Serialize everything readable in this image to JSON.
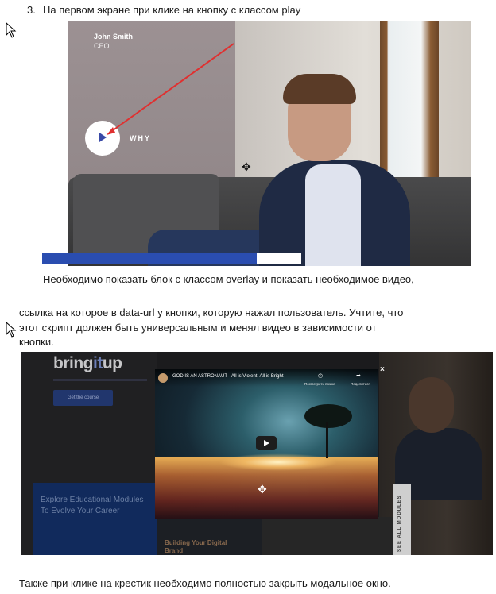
{
  "doc": {
    "item_number": "3.",
    "item_text": "На первом экране при клике на кнопку с классом play",
    "paragraph1": "Необходимо показать блок с классом overlay и показать необходимое видео,",
    "paragraph2_line1": "ссылка на которое в data-url у кнопки, которую нажал пользователь. Учтите, что",
    "paragraph2_line2": "этот скрипт должен быть универсальным и менял видео в зависимости от",
    "paragraph2_line3": "кнопки.",
    "paragraph3": "Также при клике на крестик необходимо полностью закрыть модальное окно."
  },
  "screenshot1": {
    "hero_name": "John Smith",
    "hero_role": "CEO",
    "why_label": "WHY",
    "play_icon": "play-icon",
    "move_icon": "move-cursor-icon",
    "annotation_color": "#e03030",
    "progress_color": "#2a4db0"
  },
  "screenshot2": {
    "brand_prefix": "bring",
    "brand_accent": "it",
    "brand_suffix": "up",
    "brand_accent_color": "#6c7fb8",
    "cta_label": "Get the course",
    "edu_text": "Explore Educational Modules To Evolve Your Career",
    "tile_text": "Building Your Digital Brand",
    "all_modules": "SEE ALL MODULES",
    "video_title": "GOD IS AN ASTRONAUT - All is Violent, All is Bright",
    "watch_later_label": "Посмотреть позже",
    "share_label": "Поделиться",
    "close_symbol": "×",
    "play_icon": "youtube-play-icon"
  }
}
